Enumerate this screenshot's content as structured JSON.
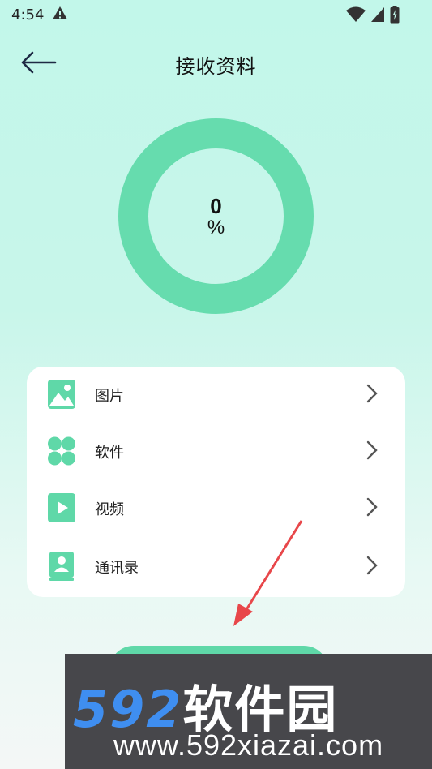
{
  "status": {
    "time": "4:54"
  },
  "header": {
    "title": "接收资料"
  },
  "progress": {
    "value": "0",
    "unit": "%",
    "fraction": 0
  },
  "items": [
    {
      "label": "图片",
      "icon": "image-icon"
    },
    {
      "label": "软件",
      "icon": "apps-icon"
    },
    {
      "label": "视频",
      "icon": "video-icon"
    },
    {
      "label": "通讯录",
      "icon": "contacts-icon"
    }
  ],
  "watermark": {
    "logo_digits": "592",
    "logo_text": "软件园",
    "url": "www.592xiazai.com"
  },
  "colors": {
    "accent": "#5fd8a8",
    "ring": "#66dcae",
    "background": "#c2f7ea",
    "arrow": "#e8474a"
  }
}
